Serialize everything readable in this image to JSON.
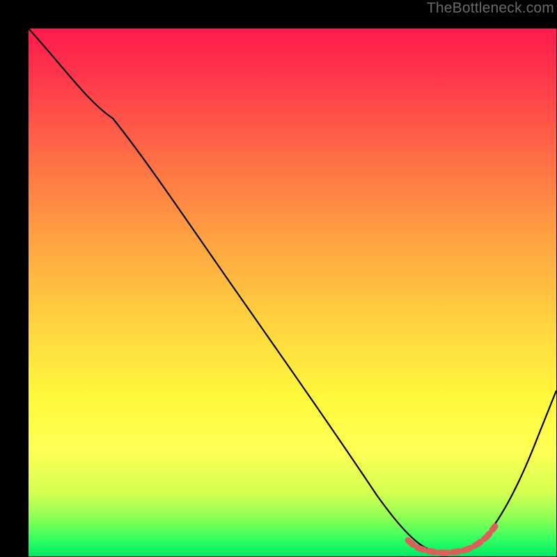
{
  "watermark": "TheBottleneck.com",
  "chart_data": {
    "type": "line",
    "title": "",
    "xlabel": "",
    "ylabel": "",
    "xlim": [
      0,
      100
    ],
    "ylim": [
      0,
      100
    ],
    "series": [
      {
        "name": "main-curve",
        "x": [
          0,
          8,
          16,
          24,
          32,
          40,
          48,
          56,
          64,
          70,
          74,
          78,
          82,
          86,
          90,
          100
        ],
        "values": [
          100,
          92,
          83,
          73,
          63,
          52,
          41,
          30,
          19,
          10,
          4,
          1,
          1,
          4,
          12,
          42
        ]
      },
      {
        "name": "highlight-segment",
        "x": [
          72,
          74,
          76,
          78,
          80,
          82,
          84,
          86,
          88
        ],
        "values": [
          2,
          1.2,
          0.8,
          0.7,
          0.7,
          0.8,
          1.2,
          2,
          3.5
        ]
      }
    ],
    "colors": {
      "main_curve": "#000000",
      "highlight": "#d9605b",
      "gradient_top": "#ff1a4d",
      "gradient_bottom": "#00e865"
    }
  }
}
